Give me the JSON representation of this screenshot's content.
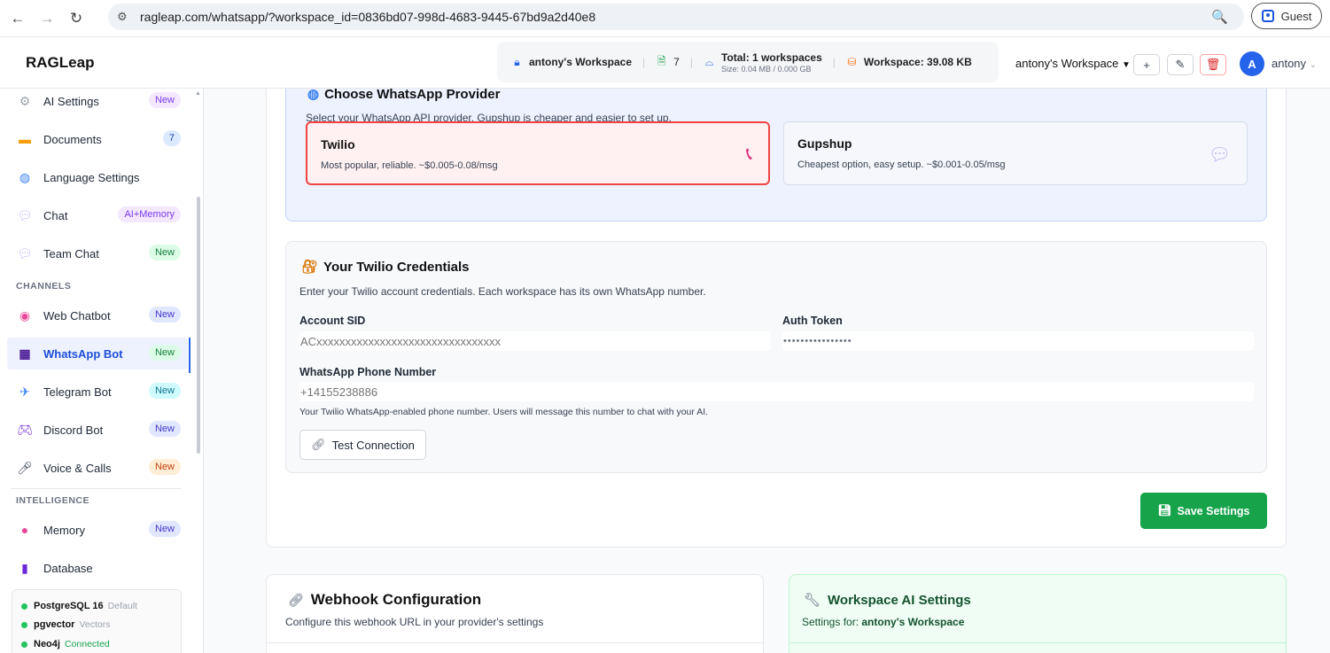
{
  "browser": {
    "url": "ragleap.com/whatsapp/?workspace_id=0836bd07-998d-4683-9445-67bd9a2d40e8",
    "guest_label": "Guest"
  },
  "header": {
    "brand": "RAGLeap",
    "workspace_name": "antony's Workspace",
    "doc_count": "7",
    "total_workspaces": "Total: 1 workspaces",
    "size_info": "Size: 0.04 MB / 0.000 GB",
    "workspace_size": "Workspace: 39.08 KB",
    "workspace_select": "antony's Workspace",
    "avatar_letter": "A",
    "username": "antony"
  },
  "sidebar": {
    "items": [
      {
        "label": "AI Settings",
        "badge": "New",
        "icon": "gear-icon"
      },
      {
        "label": "Documents",
        "badge": "7",
        "icon": "folder-icon"
      },
      {
        "label": "Language Settings",
        "icon": "globe-icon"
      },
      {
        "label": "Chat",
        "badge": "AI+Memory",
        "icon": "chat-bubble-icon"
      },
      {
        "label": "Team Chat",
        "badge": "New",
        "icon": "chat-bubble-icon"
      }
    ],
    "channels_header": "CHANNELS",
    "channels": [
      {
        "label": "Web Chatbot",
        "badge": "New",
        "icon": "robot-icon"
      },
      {
        "label": "WhatsApp Bot",
        "badge": "New",
        "icon": "calculator-icon"
      },
      {
        "label": "Telegram Bot",
        "badge": "New",
        "icon": "plane-icon"
      },
      {
        "label": "Discord Bot",
        "badge": "New",
        "icon": "gamepad-icon"
      },
      {
        "label": "Voice & Calls",
        "badge": "New",
        "icon": "microphone-icon"
      }
    ],
    "intelligence_header": "INTELLIGENCE",
    "intelligence": [
      {
        "label": "Memory",
        "badge": "New",
        "icon": "brain-icon"
      },
      {
        "label": "Database",
        "icon": "database-icon"
      }
    ],
    "databases": [
      {
        "name": "PostgreSQL 16",
        "status": "Default"
      },
      {
        "name": "pgvector",
        "status": "Vectors"
      },
      {
        "name": "Neo4j",
        "status": "Connected"
      }
    ]
  },
  "provider": {
    "title": "Choose WhatsApp Provider",
    "subtitle": "Select your WhatsApp API provider. Gupshup is cheaper and easier to set up.",
    "options": [
      {
        "name": "Twilio",
        "desc": "Most popular, reliable. ~$0.005-0.08/msg",
        "selected": true
      },
      {
        "name": "Gupshup",
        "desc": "Cheapest option, easy setup. ~$0.001-0.05/msg",
        "selected": false
      }
    ]
  },
  "credentials": {
    "title": "Your Twilio Credentials",
    "subtitle": "Enter your Twilio account credentials. Each workspace has its own WhatsApp number.",
    "sid_label": "Account SID",
    "sid_placeholder": "ACxxxxxxxxxxxxxxxxxxxxxxxxxxxxxxxx",
    "token_label": "Auth Token",
    "token_value": "••••••••••••••••",
    "phone_label": "WhatsApp Phone Number",
    "phone_placeholder": "+14155238886",
    "phone_hint": "Your Twilio WhatsApp-enabled phone number. Users will message this number to chat with your AI.",
    "test_button": "Test Connection"
  },
  "save_button": "Save Settings",
  "webhook": {
    "title": "Webhook Configuration",
    "subtitle": "Configure this webhook URL in your provider's settings"
  },
  "ai_settings": {
    "title": "Workspace AI Settings",
    "settings_for": "Settings for: ",
    "workspace": "antony's Workspace"
  }
}
